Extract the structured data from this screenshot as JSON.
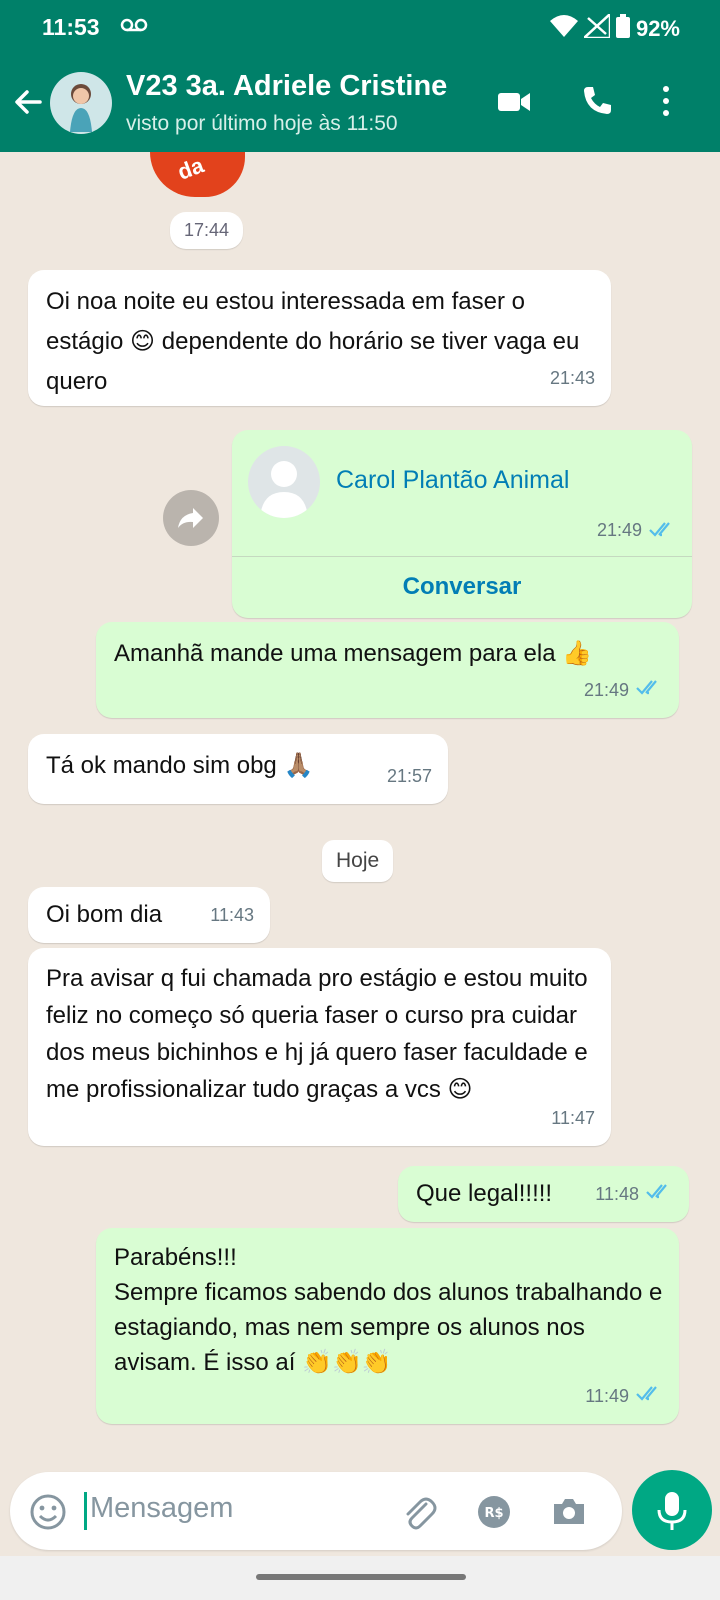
{
  "status": {
    "time": "11:53",
    "battery": "92%"
  },
  "header": {
    "contact_name": "V23 3a. Adriele Cristine",
    "last_seen": "visto por último hoje às 11:50"
  },
  "sticker": {
    "text": "da",
    "time": "17:44"
  },
  "messages": [
    {
      "dir": "in",
      "text": "Oi noa noite eu estou interessada em faser o estágio 😊 dependente do horário se tiver vaga eu quero",
      "time": "21:43"
    },
    {
      "dir": "out",
      "text": "Amanhã mande uma mensagem para ela 👍",
      "time": "21:49"
    },
    {
      "dir": "in",
      "text": "Tá ok mando sim obg 🙏🏽",
      "time": "21:57"
    },
    {
      "dir": "in",
      "text": "Oi bom dia",
      "time": "11:43"
    },
    {
      "dir": "in",
      "text": "Pra avisar q fui chamada pro estágio e estou muito feliz no começo só queria faser o curso pra cuidar dos meus bichinhos e hj já quero faser faculdade e me profissionalizar tudo graças a vcs 😊",
      "time": "11:47"
    },
    {
      "dir": "out",
      "text": "Que legal!!!!!",
      "time": "11:48"
    },
    {
      "dir": "out",
      "text": "Parabéns!!!\nSempre ficamos sabendo dos alunos trabalhando e estagiando, mas nem sempre os alunos nos avisam. É isso aí 👏👏👏",
      "time": "11:49"
    }
  ],
  "contact_card": {
    "name": "Carol Plantão Animal",
    "time": "21:49",
    "button": "Conversar"
  },
  "date_chip": "Hoje",
  "input": {
    "placeholder": "Mensagem"
  },
  "colors": {
    "header": "#008069",
    "outgoing": "#d9fdd3",
    "incoming": "#ffffff",
    "accent": "#00a884",
    "read_ticks": "#53bdeb"
  }
}
